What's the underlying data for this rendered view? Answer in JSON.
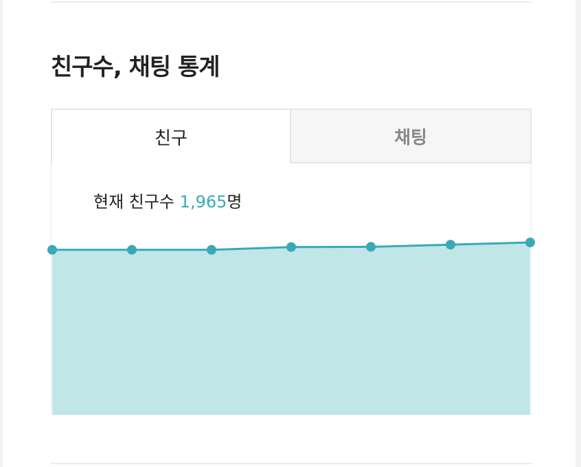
{
  "section": {
    "title": "친구수, 채팅 통계"
  },
  "tabs": [
    {
      "label": "친구",
      "active": true
    },
    {
      "label": "채팅",
      "active": false
    }
  ],
  "summary": {
    "prefix": "현재 친구수",
    "value": "1,965",
    "unit": "명"
  },
  "colors": {
    "accent": "#37aab6",
    "area_fill": "#c0e6e8",
    "active_tab_text": "#222222",
    "inactive_tab_text": "#888888"
  },
  "chart_data": {
    "type": "area",
    "title": "",
    "xlabel": "",
    "ylabel": "",
    "x": [
      1,
      2,
      3,
      4,
      5,
      6,
      7
    ],
    "series": [
      {
        "values": [
          1928,
          1928,
          1928,
          1942,
          1943,
          1954,
          1965
        ]
      }
    ],
    "ylim": [
      1100,
      2010
    ],
    "grid": false,
    "axes_visible": false,
    "markers": true
  }
}
